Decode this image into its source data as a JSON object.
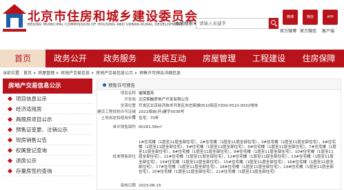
{
  "header": {
    "title": "北京市住房和城乡建设委员会",
    "subtitle": "BEIJING MUNICIPAL COMMISSION OF HOUSING AND URBAN-RURAL DEVELOPMENT",
    "search_scope": "本站搜索",
    "search_placeholder": "请输入关键字",
    "icons": [
      {
        "name": "weibo-icon",
        "label": "官方微博",
        "icon_text": "微博"
      },
      {
        "name": "wechat-icon",
        "label": "官方微信",
        "icon_text": "微信"
      },
      {
        "name": "app-icon",
        "label": "客户端",
        "icon_text": "APP"
      }
    ]
  },
  "nav": {
    "items": [
      {
        "label": "首页",
        "active": true
      },
      {
        "label": "政务公开",
        "active": false
      },
      {
        "label": "政务服务",
        "active": false
      },
      {
        "label": "政民互动",
        "active": false
      },
      {
        "label": "房屋管理",
        "active": false
      },
      {
        "label": "工程建设",
        "active": false
      },
      {
        "label": "住房保障",
        "active": false
      }
    ]
  },
  "breadcrumb": {
    "prefix": "当前位置",
    "items": [
      "首页",
      "房屋管理",
      "房地产交易信息",
      "房地产交易信息公示",
      "预售许可预告详细信息"
    ]
  },
  "sidebar": {
    "title": "房地产交易信息公示",
    "items": [
      "项目信息公示",
      "经济适用房",
      "两限房项目公示",
      "预售证变更、注销公示",
      "现房销售公告",
      "权属登记查询",
      "退房公示",
      "存量房签约查询"
    ]
  },
  "main": {
    "tab_label": "预售许可预告",
    "rows": [
      {
        "label": "项目名称",
        "value": "璀璨嘉苑"
      },
      {
        "label": "开发商",
        "value": "北京熙融房地产开发有限公司"
      },
      {
        "label": "坐落位置",
        "value": "开发区北京经济技术开发区亦庄新城0510街区YZ00-0510-0032地块"
      },
      {
        "label": "建设工程规划许可证编号",
        "value": "2021规自(开)建字0036号"
      },
      {
        "label": "土地用途和使用年限",
        "value": "住宅：70年"
      },
      {
        "label": "准许销售面积",
        "value": "90181.58m²"
      },
      {
        "label": "批准预售部位",
        "value": "1#住宅楼（1层至11层全部住宅），2#住宅楼（1层至11层全部住宅），3#住宅楼（1层至11层全部住宅），4#住宅楼（1层至11层全部住宅），5#住宅楼（1层至11层全部住宅），6#住宅楼（1层至11层全部住宅），7#住宅楼（1层至11层全部住宅），8#住宅楼（1层至11层全部住宅），9#住宅楼（1层至11层全部住宅），10#住宅楼（1层至11层全部住宅），11#住宅楼（1层至11层全部住宅），12#住宅楼（1层至11层全部住宅），13#住宅楼（1层至11层全部住宅），14#住宅楼（1层至11层全部住宅），15#住宅楼（1层至11层全部住宅），16#住宅楼（1层至11层全部住宅），17#住宅楼（1层至11层全部住宅），18#住宅楼（1层至11层全部住宅），19#住宅楼（1层至11层全部住宅），20#住宅楼（1层至11层全部住宅），21#住宅楼（1层至11层全部住宅）"
      },
      {
        "label": "审核日期",
        "value": "2023-08-15"
      }
    ]
  },
  "colors": {
    "brand_red": "#b8131a",
    "nav_active_bg": "#f1ddc7",
    "tab_dot": "#1a5fa8"
  }
}
